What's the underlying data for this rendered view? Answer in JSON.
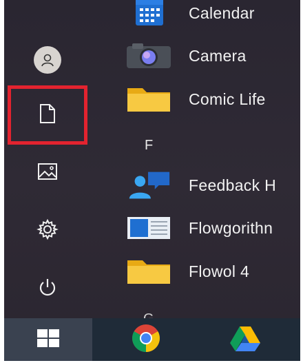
{
  "start_menu": {
    "rail": {
      "items": [
        {
          "name": "user-account",
          "icon": "person-icon"
        },
        {
          "name": "documents",
          "icon": "document-icon"
        },
        {
          "name": "pictures",
          "icon": "picture-icon"
        },
        {
          "name": "settings",
          "icon": "gear-icon"
        },
        {
          "name": "power",
          "icon": "power-icon"
        }
      ]
    },
    "apps": [
      {
        "label": "Calendar",
        "icon": "calendar-icon"
      },
      {
        "label": "Camera",
        "icon": "camera-icon"
      },
      {
        "label": "Comic Life",
        "icon": "folder-icon"
      },
      {
        "label": "Feedback H",
        "icon": "feedback-hub-icon"
      },
      {
        "label": "Flowgorithn",
        "icon": "flowgorithm-icon"
      },
      {
        "label": "Flowol 4",
        "icon": "folder-icon"
      }
    ],
    "section_letter_f": "F",
    "section_letter_next": "G"
  },
  "taskbar": {
    "items": [
      {
        "name": "start",
        "icon": "windows-logo-icon"
      },
      {
        "name": "chrome",
        "icon": "chrome-icon"
      },
      {
        "name": "google-drive",
        "icon": "google-drive-icon"
      }
    ]
  },
  "colors": {
    "highlight": "#e3232f",
    "folder": "#f5c22c",
    "taskbar": "#1f2b38"
  }
}
